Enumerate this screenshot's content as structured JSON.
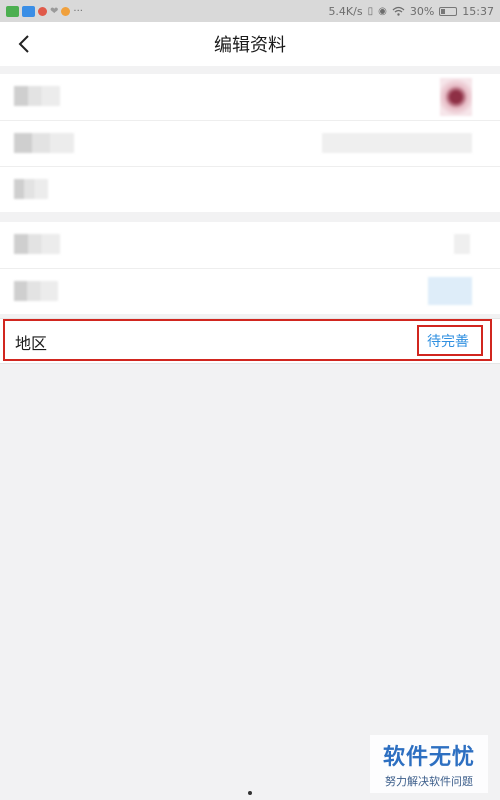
{
  "status_bar": {
    "network_speed": "5.4K/s",
    "battery": "30%",
    "battery_level": 0.3,
    "time": "15:37",
    "icons": [
      "app-green-icon",
      "app-blue-icon",
      "app-red-icon",
      "heart-icon",
      "app-orange-icon",
      "more-dots-icon",
      "vibrate-icon",
      "eye-icon",
      "wifi-icon",
      "battery-icon"
    ]
  },
  "navbar": {
    "back_icon": "chevron-left-icon",
    "title": "编辑资料"
  },
  "region_row": {
    "label": "地区",
    "value": "待完善"
  },
  "watermark": {
    "title": "软件无忧",
    "subtitle": "努力解决软件问题"
  },
  "colors": {
    "accent_link": "#2f8fe0",
    "highlight_border": "#d1261f",
    "background": "#f2f2f3"
  }
}
